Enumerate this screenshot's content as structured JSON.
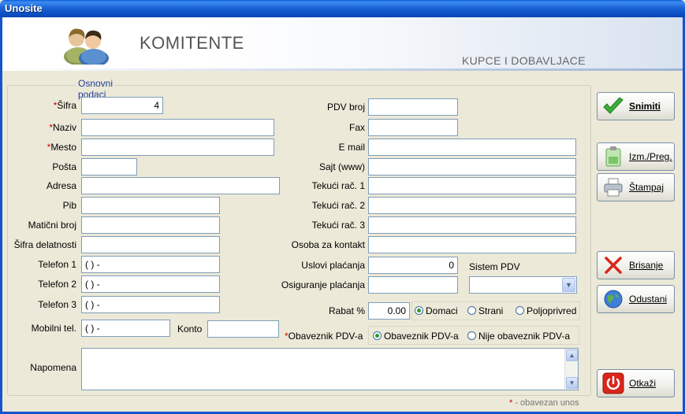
{
  "window": {
    "title": "Unosite"
  },
  "header": {
    "title": "KOMITENTE",
    "subtitle": "KUPCE I DOBAVLJACE",
    "icon": "users-icon"
  },
  "group": {
    "legend": "Osnovni podaci"
  },
  "required_mark": "*",
  "left_fields": [
    {
      "label": "Šifra",
      "required": true,
      "value": "4"
    },
    {
      "label": "Naziv",
      "required": true,
      "value": ""
    },
    {
      "label": "Mesto",
      "required": true,
      "value": ""
    },
    {
      "label": "Pošta",
      "value": ""
    },
    {
      "label": "Adresa",
      "value": ""
    },
    {
      "label": "Pib",
      "value": ""
    },
    {
      "label": "Matični broj",
      "value": ""
    },
    {
      "label": "Šifra delatnosti",
      "value": ""
    },
    {
      "label": "Telefon 1",
      "value": "(   )      -"
    },
    {
      "label": "Telefon 2",
      "value": "(   )      -"
    },
    {
      "label": "Telefon 3",
      "value": "(   )      -"
    },
    {
      "label": "Mobilni tel.",
      "value": "(   )      -"
    }
  ],
  "konto": {
    "label": "Konto",
    "value": ""
  },
  "right_fields": [
    {
      "label": "PDV broj",
      "value": ""
    },
    {
      "label": "Fax",
      "value": ""
    },
    {
      "label": "E mail",
      "value": ""
    },
    {
      "label": "Sajt (www)",
      "value": ""
    },
    {
      "label": "Tekući rač. 1",
      "value": ""
    },
    {
      "label": "Tekući rač. 2",
      "value": ""
    },
    {
      "label": "Tekući rač. 3",
      "value": ""
    },
    {
      "label": "Osoba za kontakt",
      "value": ""
    },
    {
      "label": "Uslovi plaćanja",
      "value": "0"
    },
    {
      "label": "Osiguranje plaćanja",
      "value": ""
    }
  ],
  "sistem_pdv": {
    "label": "Sistem PDV",
    "value": ""
  },
  "rabat": {
    "label": "Rabat %",
    "value": "0.00"
  },
  "market_options": [
    {
      "label": "Domaci",
      "selected": true
    },
    {
      "label": "Strani",
      "selected": false
    },
    {
      "label": "Poljoprivred",
      "selected": false
    }
  ],
  "obaveznik": {
    "label": "Obaveznik PDV-a",
    "options": [
      {
        "label": "Obaveznik PDV-a",
        "selected": true
      },
      {
        "label": "Nije obaveznik PDV-a",
        "selected": false
      }
    ]
  },
  "napomena": {
    "label": "Napomena",
    "value": ""
  },
  "buttons": {
    "snimiti": "Snimiti",
    "izmpreg": "Izm./Preg.",
    "stampaj": "Štampaj",
    "brisanje": "Brisanje",
    "odustani": "Odustani",
    "otkazi": "Otkaži"
  },
  "footer": {
    "mark": "*",
    "text": " - obavezan unos"
  },
  "colors": {
    "titlebar": "#0b4fc4",
    "required": "#d00000",
    "legend": "#1f3f9a"
  }
}
